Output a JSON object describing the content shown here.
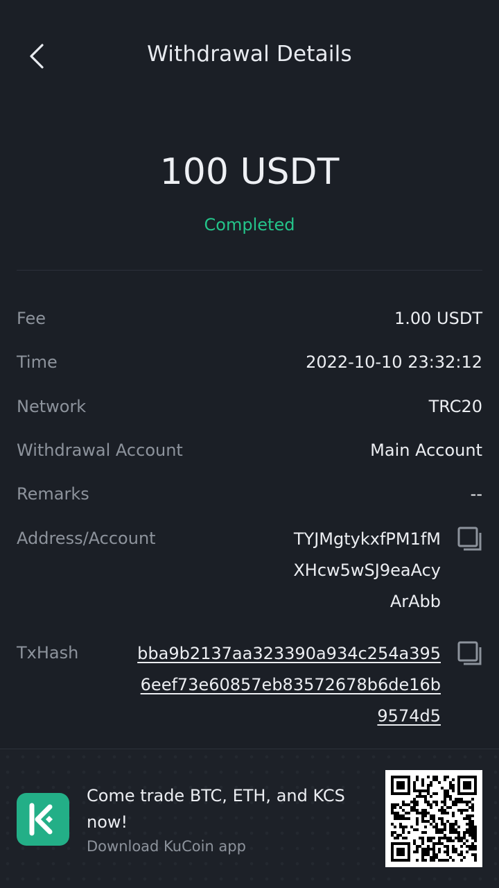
{
  "header": {
    "title": "Withdrawal Details",
    "back_icon": "chevron-left-icon"
  },
  "summary": {
    "amount": "100 USDT",
    "status": "Completed",
    "status_color": "#24c48a"
  },
  "details": {
    "fee": {
      "label": "Fee",
      "value": "1.00 USDT"
    },
    "time": {
      "label": "Time",
      "value": "2022-10-10 23:32:12"
    },
    "network": {
      "label": "Network",
      "value": "TRC20"
    },
    "account": {
      "label": "Withdrawal Account",
      "value": "Main Account"
    },
    "remarks": {
      "label": "Remarks",
      "value": "--"
    },
    "address": {
      "label": "Address/Account",
      "lines": [
        "TYJMgtykxfPM1fM",
        "XHcw5wSJ9eaAcy",
        "ArAbb"
      ],
      "copy_icon": "copy-icon"
    },
    "txhash": {
      "label": "TxHash",
      "lines": [
        "bba9b2137aa323390a934c254a395",
        "6eef73e60857eb83572678b6de16b",
        "9574d5"
      ],
      "copy_icon": "copy-icon"
    }
  },
  "footer": {
    "promo_text": "Come trade BTC, ETH, and KCS now!",
    "sub_text": "Download KuCoin app",
    "logo_icon": "kucoin-logo-icon",
    "logo_color": "#23af87",
    "qr_icon": "qr-code-icon"
  }
}
